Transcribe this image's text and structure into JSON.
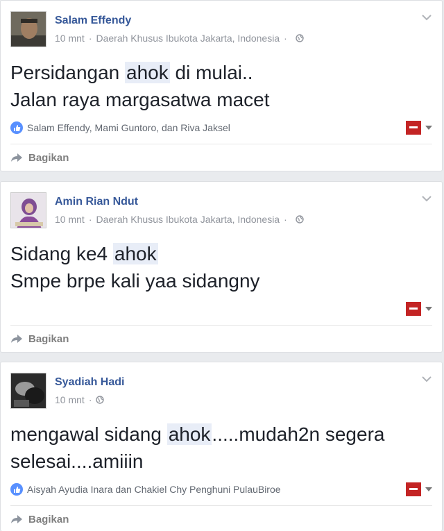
{
  "posts": [
    {
      "author": "Salam Effendy",
      "time": "10 mnt",
      "separator": "·",
      "location": "Daerah Khusus Ibukota Jakarta, Indonesia",
      "lines": [
        {
          "before": "Persidangan ",
          "highlight": "ahok",
          "after": " di mulai.."
        },
        {
          "before": "Jalan raya margasatwa macet",
          "highlight": "",
          "after": ""
        }
      ],
      "reactions": "Salam Effendy, Mami Guntoro, dan Riva Jaksel",
      "share_label": "Bagikan"
    },
    {
      "author": "Amin Rian Ndut",
      "time": "10 mnt",
      "separator": "·",
      "location": "Daerah Khusus Ibukota Jakarta, Indonesia",
      "lines": [
        {
          "before": "Sidang ke4 ",
          "highlight": "ahok",
          "after": ""
        },
        {
          "before": "Smpe brpe kali yaa sidangny",
          "highlight": "",
          "after": ""
        }
      ],
      "reactions": "",
      "share_label": "Bagikan"
    },
    {
      "author": "Syadiah Hadi",
      "time": "10 mnt",
      "separator": "·",
      "location": "",
      "lines": [
        {
          "before": "mengawal sidang ",
          "highlight": "ahok",
          "after": ".....mudah2n segera"
        },
        {
          "before": "selesai....amiiin",
          "highlight": "",
          "after": ""
        }
      ],
      "reactions": "Aisyah Ayudia Inara dan Chakiel Chy Penghuni PulauBiroe",
      "share_label": "Bagikan"
    }
  ],
  "colors": {
    "name": "#365899",
    "meta": "#90949c",
    "like": "#5890ff",
    "highlight": "#e8edf7",
    "flag": "#c32424"
  },
  "icons": {
    "options": "chevron-down-icon",
    "privacy": "globe-icon",
    "like": "like-icon",
    "share": "share-arrow-icon",
    "language": "language-flag-icon"
  }
}
